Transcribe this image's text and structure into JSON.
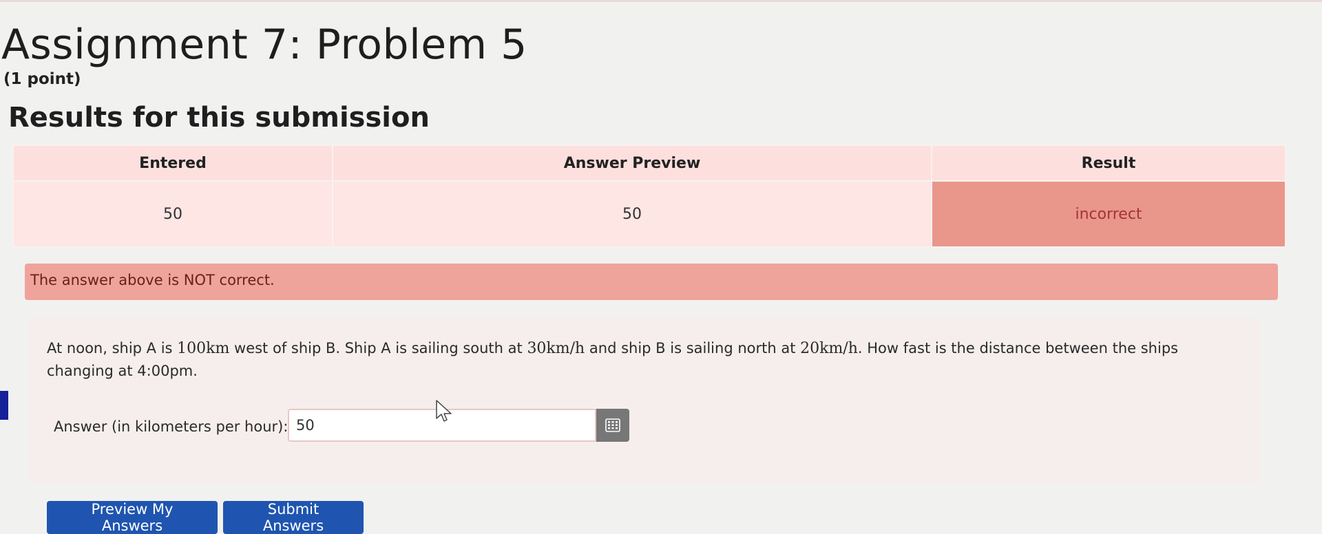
{
  "page": {
    "title": "Assignment 7: Problem 5",
    "points": "(1 point)"
  },
  "results": {
    "heading": "Results for this submission",
    "headers": [
      "Entered",
      "Answer Preview",
      "Result"
    ],
    "row": {
      "entered": "50",
      "preview": "50",
      "result": "incorrect"
    }
  },
  "alert": {
    "text": "The answer above is NOT correct."
  },
  "problem": {
    "text_part1": "At noon, ship A is ",
    "dist": "100km",
    "text_part2": " west of ship B. Ship A is sailing south at ",
    "speed_a": "30km/h",
    "text_part3": " and ship B is sailing north at ",
    "speed_b": "20km/h",
    "text_part4": ". How fast is the distance between the ships changing at 4:00pm.",
    "answer_label": "Answer (in kilometers per hour):",
    "answer_value": "50"
  },
  "buttons": {
    "preview": "Preview My Answers",
    "submit": "Submit Answers"
  },
  "colors": {
    "incorrect_cell": "#e9968b",
    "alert_bg": "#eea49a",
    "button_bg": "#1f55b0"
  },
  "icons": {
    "calculator": "calculator-icon",
    "cursor": "mouse-pointer-icon"
  }
}
